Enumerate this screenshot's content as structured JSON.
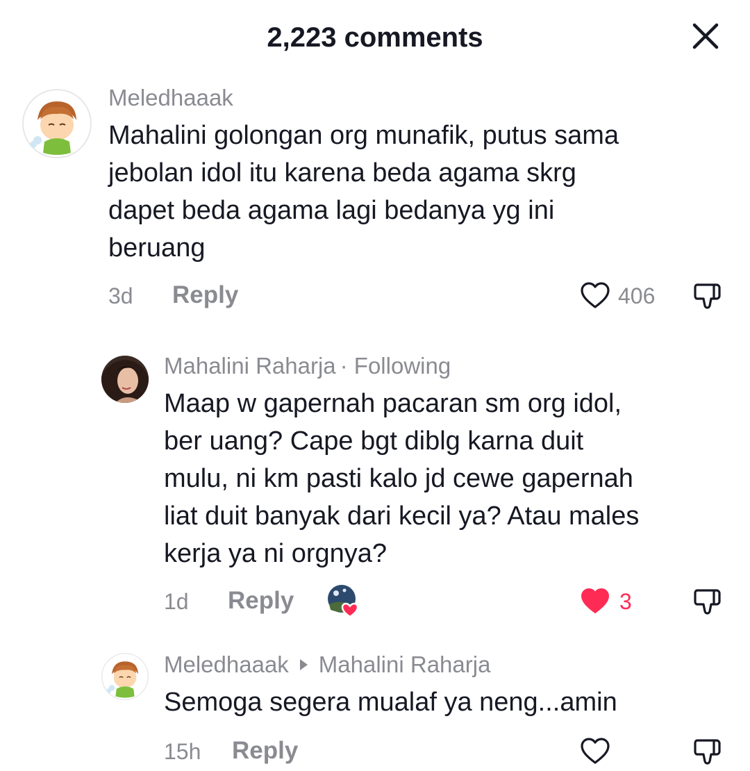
{
  "header": {
    "title": "2,223 comments"
  },
  "comments": [
    {
      "username": "Meledhaaak",
      "text_lines": [
        "Mahalini golongan org munafik, putus sama",
        "jebolan idol itu karena beda agama skrg",
        "dapet beda agama lagi bedanya yg ini",
        "beruang"
      ],
      "time": "3d",
      "reply_label": "Reply",
      "likes": "406",
      "liked": false
    },
    {
      "username": "Mahalini Raharja",
      "badge": "· Following",
      "text_lines": [
        "Maap w gapernah pacaran sm org idol,",
        "ber uang? Cape bgt diblg karna duit",
        "mulu, ni km pasti kalo jd cewe gapernah",
        "liat duit banyak dari kecil ya? Atau males",
        "kerja ya ni orgnya?"
      ],
      "time": "1d",
      "reply_label": "Reply",
      "likes": "3",
      "liked": true
    },
    {
      "username": "Meledhaaak",
      "reply_to": "Mahalini Raharja",
      "text_lines": [
        "Semoga segera mualaf ya neng...amin"
      ],
      "time": "15h",
      "reply_label": "Reply",
      "likes": "",
      "liked": false
    }
  ],
  "colors": {
    "accent_red": "#fe2c55",
    "muted": "#8a8b91",
    "text": "#161823"
  },
  "icons": [
    "close-icon",
    "heart-icon",
    "heart-filled-icon",
    "dislike-icon",
    "creator-liked-icon"
  ]
}
